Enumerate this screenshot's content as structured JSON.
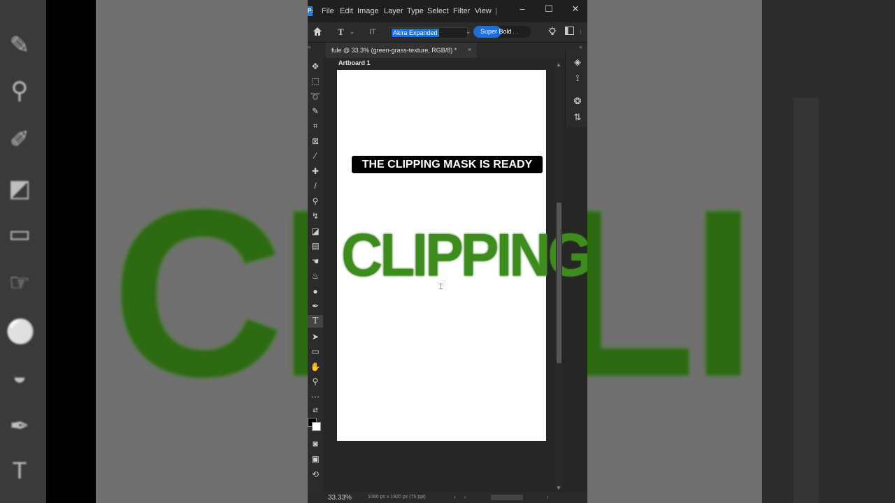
{
  "app": {
    "logo_text": "Ps",
    "menu": [
      "File",
      "Edit",
      "Image",
      "Layer",
      "Type",
      "Select",
      "Filter",
      "View"
    ],
    "menu_separator": "|",
    "window_controls": {
      "minimize": "–",
      "maximize": "☐",
      "close": "✕"
    }
  },
  "options_bar": {
    "home_icon": "home-icon",
    "type_tool_icon": "T",
    "orientation_icon": "IT",
    "font_family": "Akira Expanded",
    "font_style": "Super Bold",
    "font_style_extra": "'  .  .",
    "caret": "⌄"
  },
  "document": {
    "tab_title": "fule @ 33.3% (green-grass-texture, RGB/8) *",
    "tab_close": "×",
    "artboard_label": "Artboard 1",
    "caption_text": "THE CLIPPING MASK IS READY",
    "headline_text": "CLIPPING",
    "colors": {
      "grass": "#3e8c1f",
      "caption_bg": "#000000",
      "selection_blue": "#1c6fd6"
    }
  },
  "status": {
    "zoom": "33.33%",
    "doc_info": "1080 px x 1920 px (75 ppi)",
    "arrow_right": "›",
    "arrow_left": "‹",
    "arrow_right_end": "›"
  },
  "background": {
    "word": "CLIPPING",
    "word_right": "NG"
  },
  "tools": [
    "move-tool-icon",
    "marquee-tool-icon",
    "lasso-tool-icon",
    "quick-select-tool-icon",
    "crop-tool-icon",
    "frame-tool-icon",
    "eyedropper-tool-icon",
    "healing-brush-tool-icon",
    "brush-tool-icon",
    "clone-stamp-tool-icon",
    "history-brush-tool-icon",
    "eraser-tool-icon",
    "gradient-tool-icon",
    "smudge-tool-icon",
    "dodge-tool-icon",
    "sponge-tool-icon",
    "pen-tool-icon",
    "type-tool-icon",
    "path-select-tool-icon",
    "rectangle-tool-icon",
    "hand-rotate-tool-icon",
    "zoom-tool-icon",
    "more-tools-icon"
  ],
  "right_panel_icons": [
    "layers-icon",
    "paths-icon",
    "channels-icon",
    "history-icon"
  ]
}
